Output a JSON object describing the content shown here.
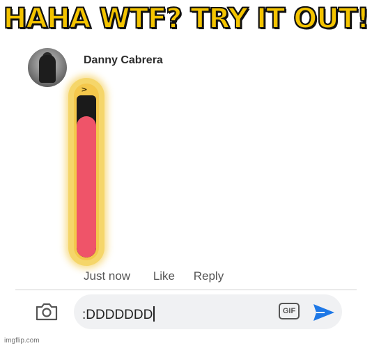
{
  "caption": "HAHA WTF? TRY IT OUT!",
  "comment": {
    "author": "Danny Cabrera",
    "actions": {
      "timestamp": "Just now",
      "like_label": "Like",
      "reply_label": "Reply"
    },
    "sticker": {
      "eyes": "> <",
      "icon": "laughing-emoji"
    }
  },
  "composer": {
    "input_value": ":DDDDDDD",
    "gif_label": "GIF",
    "camera_icon": "camera-icon",
    "send_icon": "send-icon"
  },
  "watermark": "imgflip.com",
  "colors": {
    "caption": "#f4c400",
    "emoji_yellow": "#f4c84c",
    "tongue": "#ef5469",
    "send": "#1e78e6"
  }
}
